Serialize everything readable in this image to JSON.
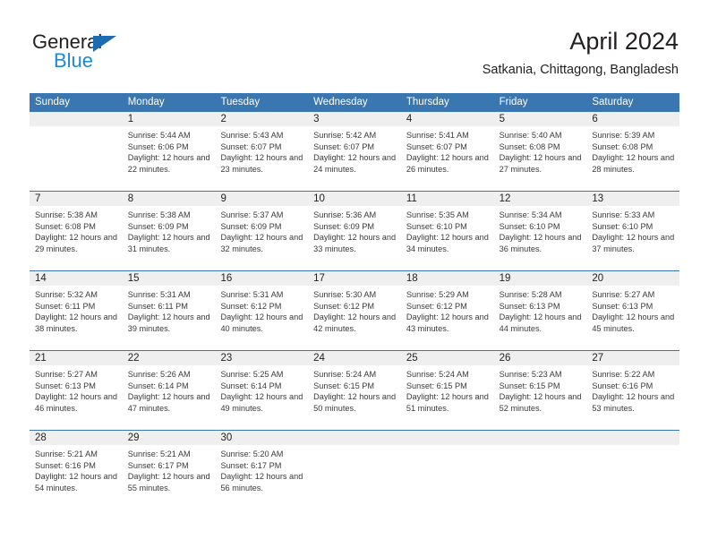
{
  "brand": {
    "name_part1": "General",
    "name_part2": "Blue",
    "triangle_icon": "triangle-icon",
    "accent_dark": "#1d6bb0",
    "accent_light": "#2089d6"
  },
  "header": {
    "title": "April 2024",
    "subtitle": "Satkania, Chittagong, Bangladesh"
  },
  "colors": {
    "header_blue": "#3a76b0",
    "daynum_band": "#efefef",
    "text": "#231f20"
  },
  "weekdays": [
    "Sunday",
    "Monday",
    "Tuesday",
    "Wednesday",
    "Thursday",
    "Friday",
    "Saturday"
  ],
  "weeks": [
    {
      "days": [
        {
          "num": "",
          "sunrise": "",
          "sunset": "",
          "daylight": "",
          "empty": true
        },
        {
          "num": "1",
          "sunrise": "Sunrise: 5:44 AM",
          "sunset": "Sunset: 6:06 PM",
          "daylight": "Daylight: 12 hours and 22 minutes.",
          "empty": false
        },
        {
          "num": "2",
          "sunrise": "Sunrise: 5:43 AM",
          "sunset": "Sunset: 6:07 PM",
          "daylight": "Daylight: 12 hours and 23 minutes.",
          "empty": false
        },
        {
          "num": "3",
          "sunrise": "Sunrise: 5:42 AM",
          "sunset": "Sunset: 6:07 PM",
          "daylight": "Daylight: 12 hours and 24 minutes.",
          "empty": false
        },
        {
          "num": "4",
          "sunrise": "Sunrise: 5:41 AM",
          "sunset": "Sunset: 6:07 PM",
          "daylight": "Daylight: 12 hours and 26 minutes.",
          "empty": false
        },
        {
          "num": "5",
          "sunrise": "Sunrise: 5:40 AM",
          "sunset": "Sunset: 6:08 PM",
          "daylight": "Daylight: 12 hours and 27 minutes.",
          "empty": false
        },
        {
          "num": "6",
          "sunrise": "Sunrise: 5:39 AM",
          "sunset": "Sunset: 6:08 PM",
          "daylight": "Daylight: 12 hours and 28 minutes.",
          "empty": false
        }
      ]
    },
    {
      "days": [
        {
          "num": "7",
          "sunrise": "Sunrise: 5:38 AM",
          "sunset": "Sunset: 6:08 PM",
          "daylight": "Daylight: 12 hours and 29 minutes.",
          "empty": false
        },
        {
          "num": "8",
          "sunrise": "Sunrise: 5:38 AM",
          "sunset": "Sunset: 6:09 PM",
          "daylight": "Daylight: 12 hours and 31 minutes.",
          "empty": false
        },
        {
          "num": "9",
          "sunrise": "Sunrise: 5:37 AM",
          "sunset": "Sunset: 6:09 PM",
          "daylight": "Daylight: 12 hours and 32 minutes.",
          "empty": false
        },
        {
          "num": "10",
          "sunrise": "Sunrise: 5:36 AM",
          "sunset": "Sunset: 6:09 PM",
          "daylight": "Daylight: 12 hours and 33 minutes.",
          "empty": false
        },
        {
          "num": "11",
          "sunrise": "Sunrise: 5:35 AM",
          "sunset": "Sunset: 6:10 PM",
          "daylight": "Daylight: 12 hours and 34 minutes.",
          "empty": false
        },
        {
          "num": "12",
          "sunrise": "Sunrise: 5:34 AM",
          "sunset": "Sunset: 6:10 PM",
          "daylight": "Daylight: 12 hours and 36 minutes.",
          "empty": false
        },
        {
          "num": "13",
          "sunrise": "Sunrise: 5:33 AM",
          "sunset": "Sunset: 6:10 PM",
          "daylight": "Daylight: 12 hours and 37 minutes.",
          "empty": false
        }
      ]
    },
    {
      "days": [
        {
          "num": "14",
          "sunrise": "Sunrise: 5:32 AM",
          "sunset": "Sunset: 6:11 PM",
          "daylight": "Daylight: 12 hours and 38 minutes.",
          "empty": false
        },
        {
          "num": "15",
          "sunrise": "Sunrise: 5:31 AM",
          "sunset": "Sunset: 6:11 PM",
          "daylight": "Daylight: 12 hours and 39 minutes.",
          "empty": false
        },
        {
          "num": "16",
          "sunrise": "Sunrise: 5:31 AM",
          "sunset": "Sunset: 6:12 PM",
          "daylight": "Daylight: 12 hours and 40 minutes.",
          "empty": false
        },
        {
          "num": "17",
          "sunrise": "Sunrise: 5:30 AM",
          "sunset": "Sunset: 6:12 PM",
          "daylight": "Daylight: 12 hours and 42 minutes.",
          "empty": false
        },
        {
          "num": "18",
          "sunrise": "Sunrise: 5:29 AM",
          "sunset": "Sunset: 6:12 PM",
          "daylight": "Daylight: 12 hours and 43 minutes.",
          "empty": false
        },
        {
          "num": "19",
          "sunrise": "Sunrise: 5:28 AM",
          "sunset": "Sunset: 6:13 PM",
          "daylight": "Daylight: 12 hours and 44 minutes.",
          "empty": false
        },
        {
          "num": "20",
          "sunrise": "Sunrise: 5:27 AM",
          "sunset": "Sunset: 6:13 PM",
          "daylight": "Daylight: 12 hours and 45 minutes.",
          "empty": false
        }
      ]
    },
    {
      "days": [
        {
          "num": "21",
          "sunrise": "Sunrise: 5:27 AM",
          "sunset": "Sunset: 6:13 PM",
          "daylight": "Daylight: 12 hours and 46 minutes.",
          "empty": false
        },
        {
          "num": "22",
          "sunrise": "Sunrise: 5:26 AM",
          "sunset": "Sunset: 6:14 PM",
          "daylight": "Daylight: 12 hours and 47 minutes.",
          "empty": false
        },
        {
          "num": "23",
          "sunrise": "Sunrise: 5:25 AM",
          "sunset": "Sunset: 6:14 PM",
          "daylight": "Daylight: 12 hours and 49 minutes.",
          "empty": false
        },
        {
          "num": "24",
          "sunrise": "Sunrise: 5:24 AM",
          "sunset": "Sunset: 6:15 PM",
          "daylight": "Daylight: 12 hours and 50 minutes.",
          "empty": false
        },
        {
          "num": "25",
          "sunrise": "Sunrise: 5:24 AM",
          "sunset": "Sunset: 6:15 PM",
          "daylight": "Daylight: 12 hours and 51 minutes.",
          "empty": false
        },
        {
          "num": "26",
          "sunrise": "Sunrise: 5:23 AM",
          "sunset": "Sunset: 6:15 PM",
          "daylight": "Daylight: 12 hours and 52 minutes.",
          "empty": false
        },
        {
          "num": "27",
          "sunrise": "Sunrise: 5:22 AM",
          "sunset": "Sunset: 6:16 PM",
          "daylight": "Daylight: 12 hours and 53 minutes.",
          "empty": false
        }
      ]
    },
    {
      "days": [
        {
          "num": "28",
          "sunrise": "Sunrise: 5:21 AM",
          "sunset": "Sunset: 6:16 PM",
          "daylight": "Daylight: 12 hours and 54 minutes.",
          "empty": false
        },
        {
          "num": "29",
          "sunrise": "Sunrise: 5:21 AM",
          "sunset": "Sunset: 6:17 PM",
          "daylight": "Daylight: 12 hours and 55 minutes.",
          "empty": false
        },
        {
          "num": "30",
          "sunrise": "Sunrise: 5:20 AM",
          "sunset": "Sunset: 6:17 PM",
          "daylight": "Daylight: 12 hours and 56 minutes.",
          "empty": false
        },
        {
          "num": "",
          "sunrise": "",
          "sunset": "",
          "daylight": "",
          "empty": true
        },
        {
          "num": "",
          "sunrise": "",
          "sunset": "",
          "daylight": "",
          "empty": true
        },
        {
          "num": "",
          "sunrise": "",
          "sunset": "",
          "daylight": "",
          "empty": true
        },
        {
          "num": "",
          "sunrise": "",
          "sunset": "",
          "daylight": "",
          "empty": true
        }
      ]
    }
  ]
}
